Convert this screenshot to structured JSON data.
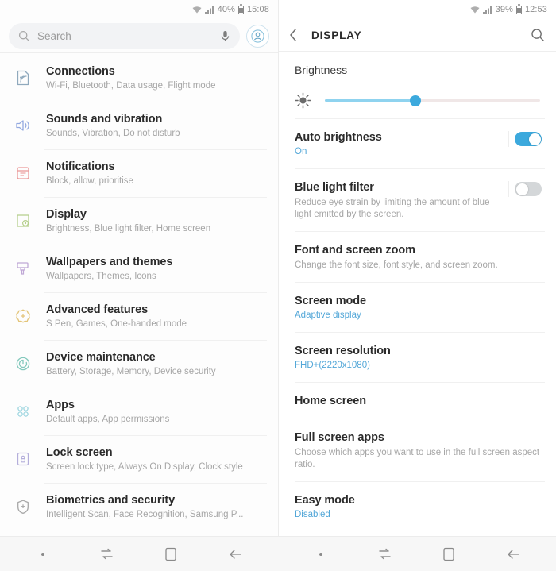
{
  "left_panel": {
    "status_bar": {
      "wifi_icon": "wifi-icon",
      "signal_icon": "signal-bars-icon",
      "battery_percent": "40%",
      "battery_icon": "battery-icon",
      "time": "15:08"
    },
    "search": {
      "placeholder": "Search",
      "search_icon": "search-icon",
      "mic_icon": "microphone-icon",
      "avatar_icon": "account-avatar-icon"
    },
    "items": [
      {
        "title": "Connections",
        "subtitle": "Wi-Fi, Bluetooth, Data usage, Flight mode",
        "icon": "connections-icon",
        "icon_color": "#8fa9bd"
      },
      {
        "title": "Sounds and vibration",
        "subtitle": "Sounds, Vibration, Do not disturb",
        "icon": "sound-speaker-icon",
        "icon_color": "#93a9e0"
      },
      {
        "title": "Notifications",
        "subtitle": "Block, allow, prioritise",
        "icon": "notifications-icon",
        "icon_color": "#eb9a9a"
      },
      {
        "title": "Display",
        "subtitle": "Brightness, Blue light filter, Home screen",
        "icon": "display-icon",
        "icon_color": "#b5cf8c"
      },
      {
        "title": "Wallpapers and themes",
        "subtitle": "Wallpapers, Themes, Icons",
        "icon": "wallpaper-brush-icon",
        "icon_color": "#c0a8d6"
      },
      {
        "title": "Advanced features",
        "subtitle": "S Pen, Games, One-handed mode",
        "icon": "advanced-features-gear-icon",
        "icon_color": "#e3c478"
      },
      {
        "title": "Device maintenance",
        "subtitle": "Battery, Storage, Memory, Device security",
        "icon": "device-maintenance-icon",
        "icon_color": "#84c9bd"
      },
      {
        "title": "Apps",
        "subtitle": "Default apps, App permissions",
        "icon": "apps-grid-icon",
        "icon_color": "#9ed6e0"
      },
      {
        "title": "Lock screen",
        "subtitle": "Screen lock type, Always On Display, Clock style",
        "icon": "lock-screen-icon",
        "icon_color": "#b4aedb"
      },
      {
        "title": "Biometrics and security",
        "subtitle": "Intelligent Scan, Face Recognition, Samsung P...",
        "icon": "security-shield-icon",
        "icon_color": "#a8a8a8"
      }
    ]
  },
  "right_panel": {
    "status_bar": {
      "wifi_icon": "wifi-icon",
      "signal_icon": "signal-bars-icon",
      "battery_percent": "39%",
      "battery_icon": "battery-icon",
      "time": "12:53"
    },
    "app_bar": {
      "title": "DISPLAY",
      "back_icon": "back-chevron-icon",
      "search_icon": "search-icon"
    },
    "brightness": {
      "label": "Brightness",
      "icon": "brightness-sun-icon",
      "slider_percent": 42
    },
    "options": [
      {
        "title": "Auto brightness",
        "value": "On",
        "desc": "",
        "toggle": "on"
      },
      {
        "title": "Blue light filter",
        "value": "",
        "desc": "Reduce eye strain by limiting the amount of blue light emitted by the screen.",
        "toggle": "off"
      },
      {
        "title": "Font and screen zoom",
        "value": "",
        "desc": "Change the font size, font style, and screen zoom.",
        "toggle": ""
      },
      {
        "title": "Screen mode",
        "value": "Adaptive display",
        "desc": "",
        "toggle": ""
      },
      {
        "title": "Screen resolution",
        "value": "FHD+(2220x1080)",
        "desc": "",
        "toggle": ""
      },
      {
        "title": "Home screen",
        "value": "",
        "desc": "",
        "toggle": ""
      },
      {
        "title": "Full screen apps",
        "value": "",
        "desc": "Choose which apps you want to use in the full screen aspect ratio.",
        "toggle": ""
      },
      {
        "title": "Easy mode",
        "value": "Disabled",
        "desc": "",
        "toggle": ""
      }
    ]
  },
  "nav_bar": {
    "buttons": [
      {
        "icon": "indicator-dot-icon"
      },
      {
        "icon": "recents-icon"
      },
      {
        "icon": "home-square-icon"
      },
      {
        "icon": "back-arrow-icon"
      }
    ]
  },
  "colors": {
    "accent_blue": "#3ca9dd",
    "link_blue": "#53a7d8",
    "toggle_off": "#d4d7d9",
    "title_text": "#2b2b2b",
    "sub_text": "#a6a6a6"
  }
}
